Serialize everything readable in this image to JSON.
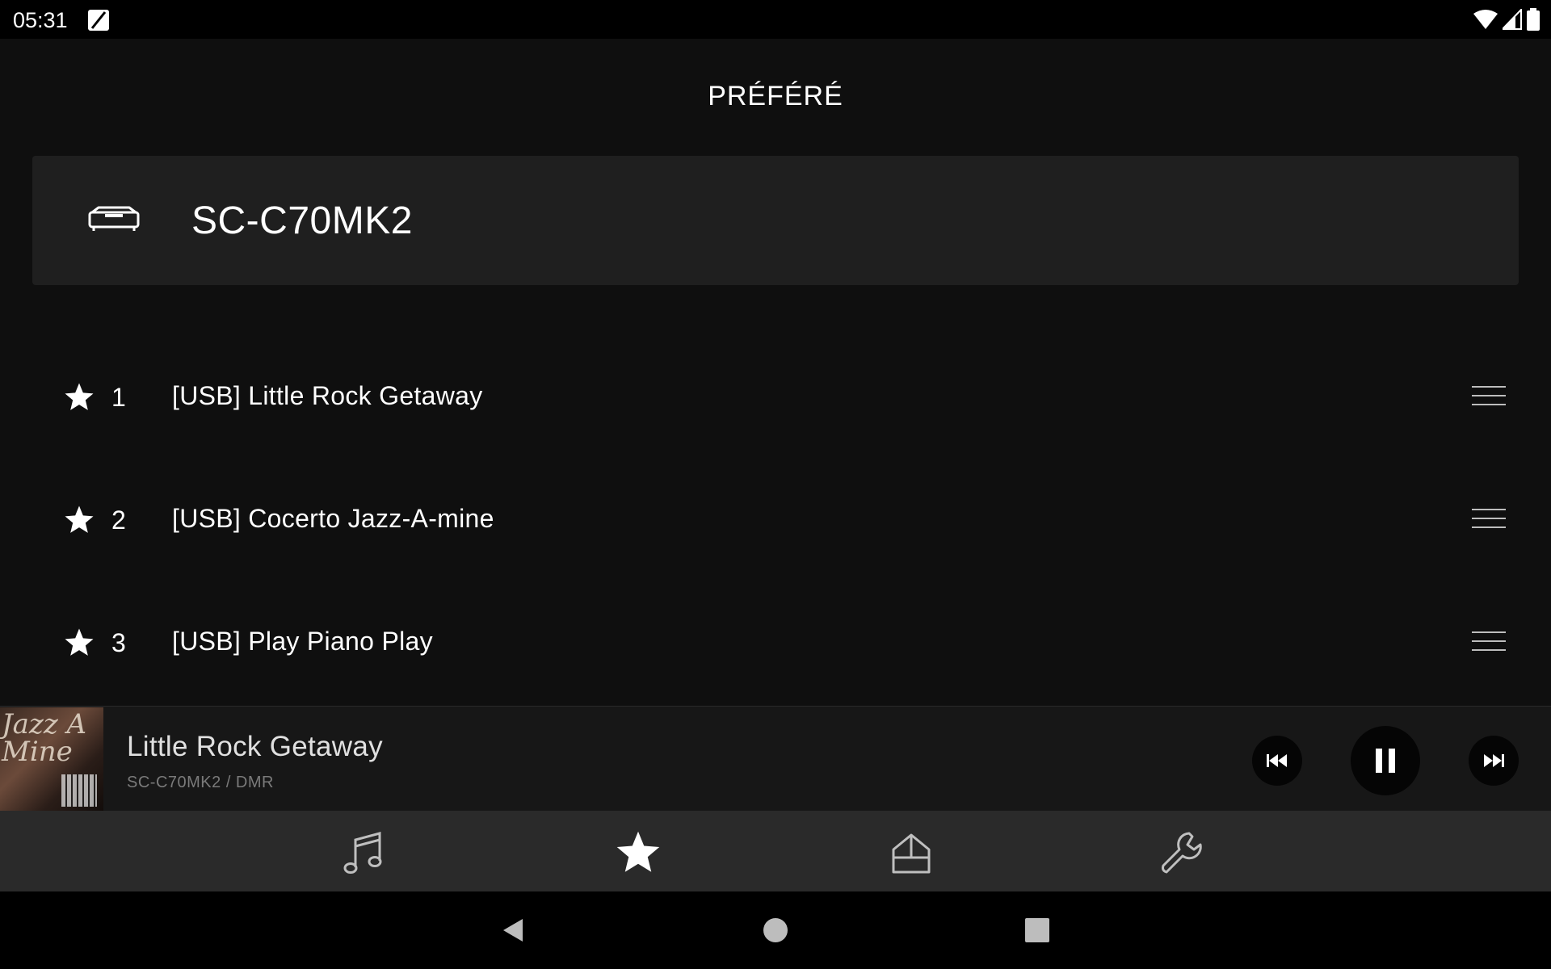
{
  "status_bar": {
    "time": "05:31",
    "icons": [
      "app-notification-icon",
      "wifi-icon",
      "signal-icon",
      "battery-icon"
    ]
  },
  "page": {
    "title": "PRÉFÉRÉ"
  },
  "device": {
    "icon": "device-speaker-icon",
    "name": "SC-C70MK2"
  },
  "favorites": [
    {
      "number": "1",
      "title": "[USB] Little Rock Getaway"
    },
    {
      "number": "2",
      "title": "[USB] Cocerto Jazz-A-mine"
    },
    {
      "number": "3",
      "title": "[USB] Play Piano Play"
    }
  ],
  "now_playing": {
    "title": "Little Rock Getaway",
    "subtitle": "SC-C70MK2  / DMR",
    "album_art_text": "Jazz A Mine"
  },
  "bottom_nav": {
    "items": [
      "music-icon",
      "star-icon",
      "home-icon",
      "wrench-icon"
    ],
    "active": "star-icon"
  },
  "colors": {
    "background": "#0f0f0f",
    "card": "#1f1f1f",
    "player_bar": "#171717",
    "nav_bar": "#2a2a2a",
    "text": "#ffffff",
    "subtext": "#7a7a7a"
  }
}
